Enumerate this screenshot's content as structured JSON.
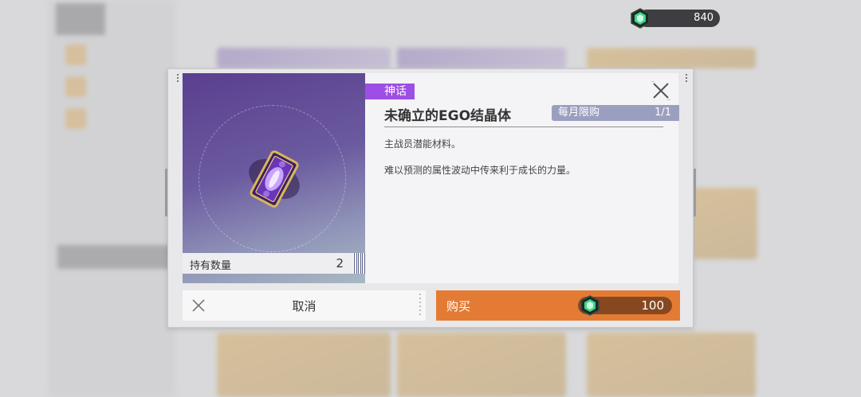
{
  "currency": {
    "icon": "gem-icon",
    "amount": "840"
  },
  "dialog": {
    "rarity": "神话",
    "item_name": "未确立的EGO结晶体",
    "limit_label": "每月限购",
    "limit_count": "1/1",
    "description_1": "主战员潜能材料。",
    "description_2": "难以预测的属性波动中传来利于成长的力量。",
    "owned_label": "持有数量",
    "owned_count": "2",
    "item_icon": "ego-crystal-card-icon"
  },
  "buttons": {
    "cancel_label": "取消",
    "buy_label": "购买",
    "price": "100",
    "price_icon": "gem-icon"
  },
  "colors": {
    "rarity": "#9d4ee4",
    "buy": "#e37b34",
    "limit_badge": "#9b9fbf"
  }
}
